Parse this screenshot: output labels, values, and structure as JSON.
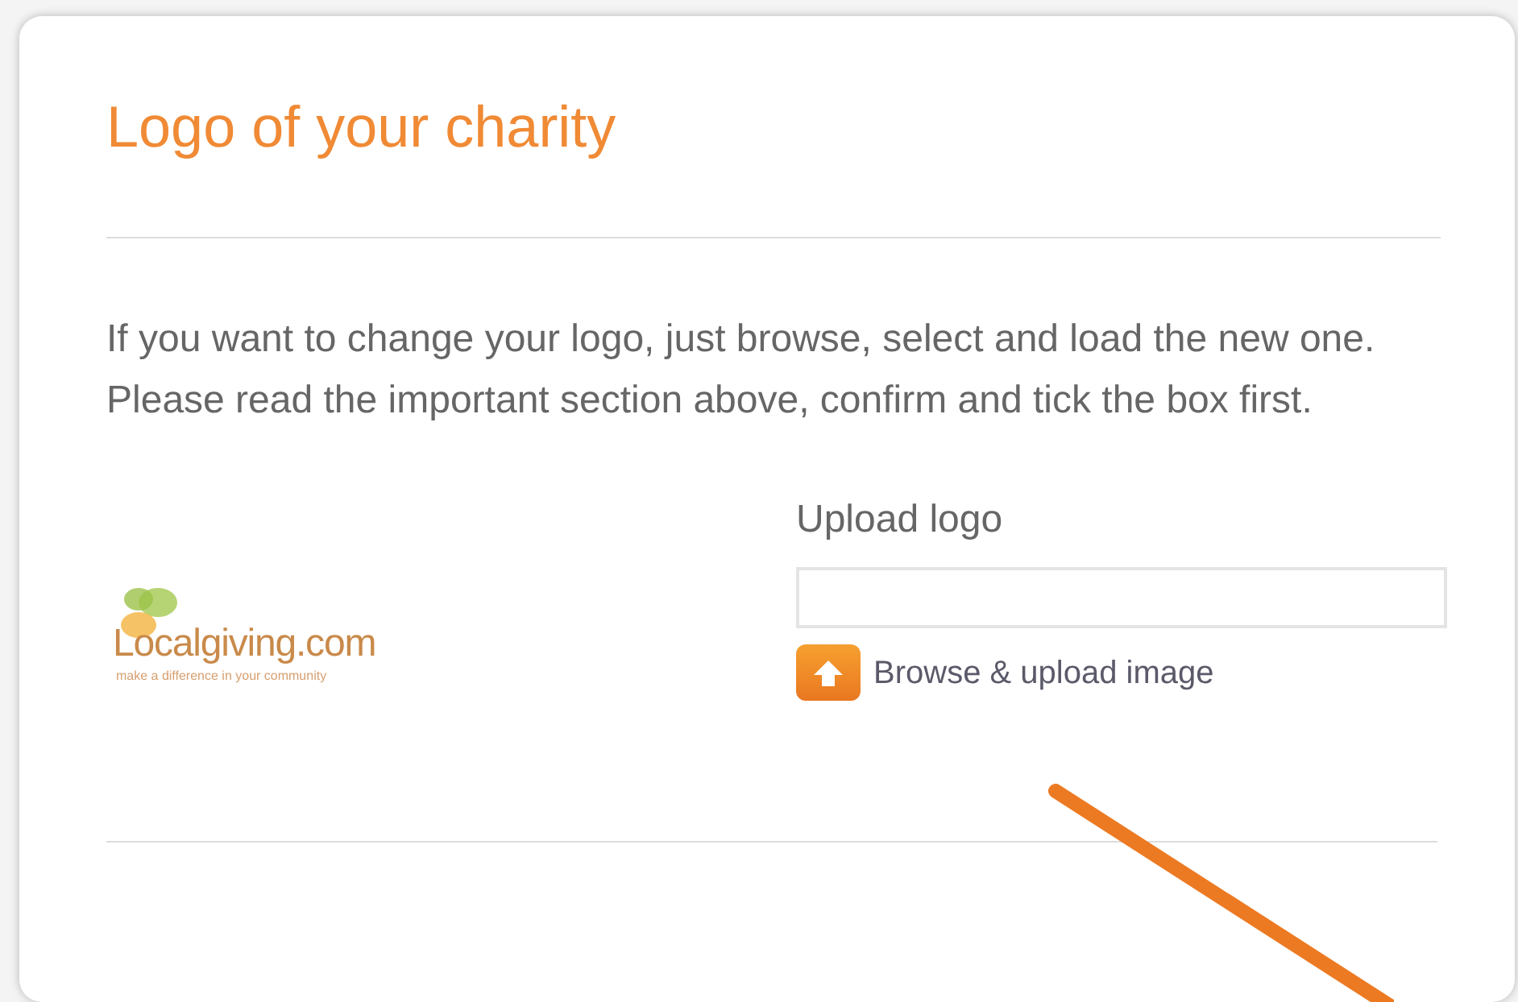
{
  "section": {
    "title": "Logo of your charity",
    "description": "If you want to change your logo, just browse, select and load the new one. Please read the important section above, confirm and tick the box first."
  },
  "logo": {
    "name": "Localgiving.com",
    "tagline": "make a difference in your community"
  },
  "upload": {
    "label": "Upload logo",
    "button": "Browse & upload image"
  }
}
